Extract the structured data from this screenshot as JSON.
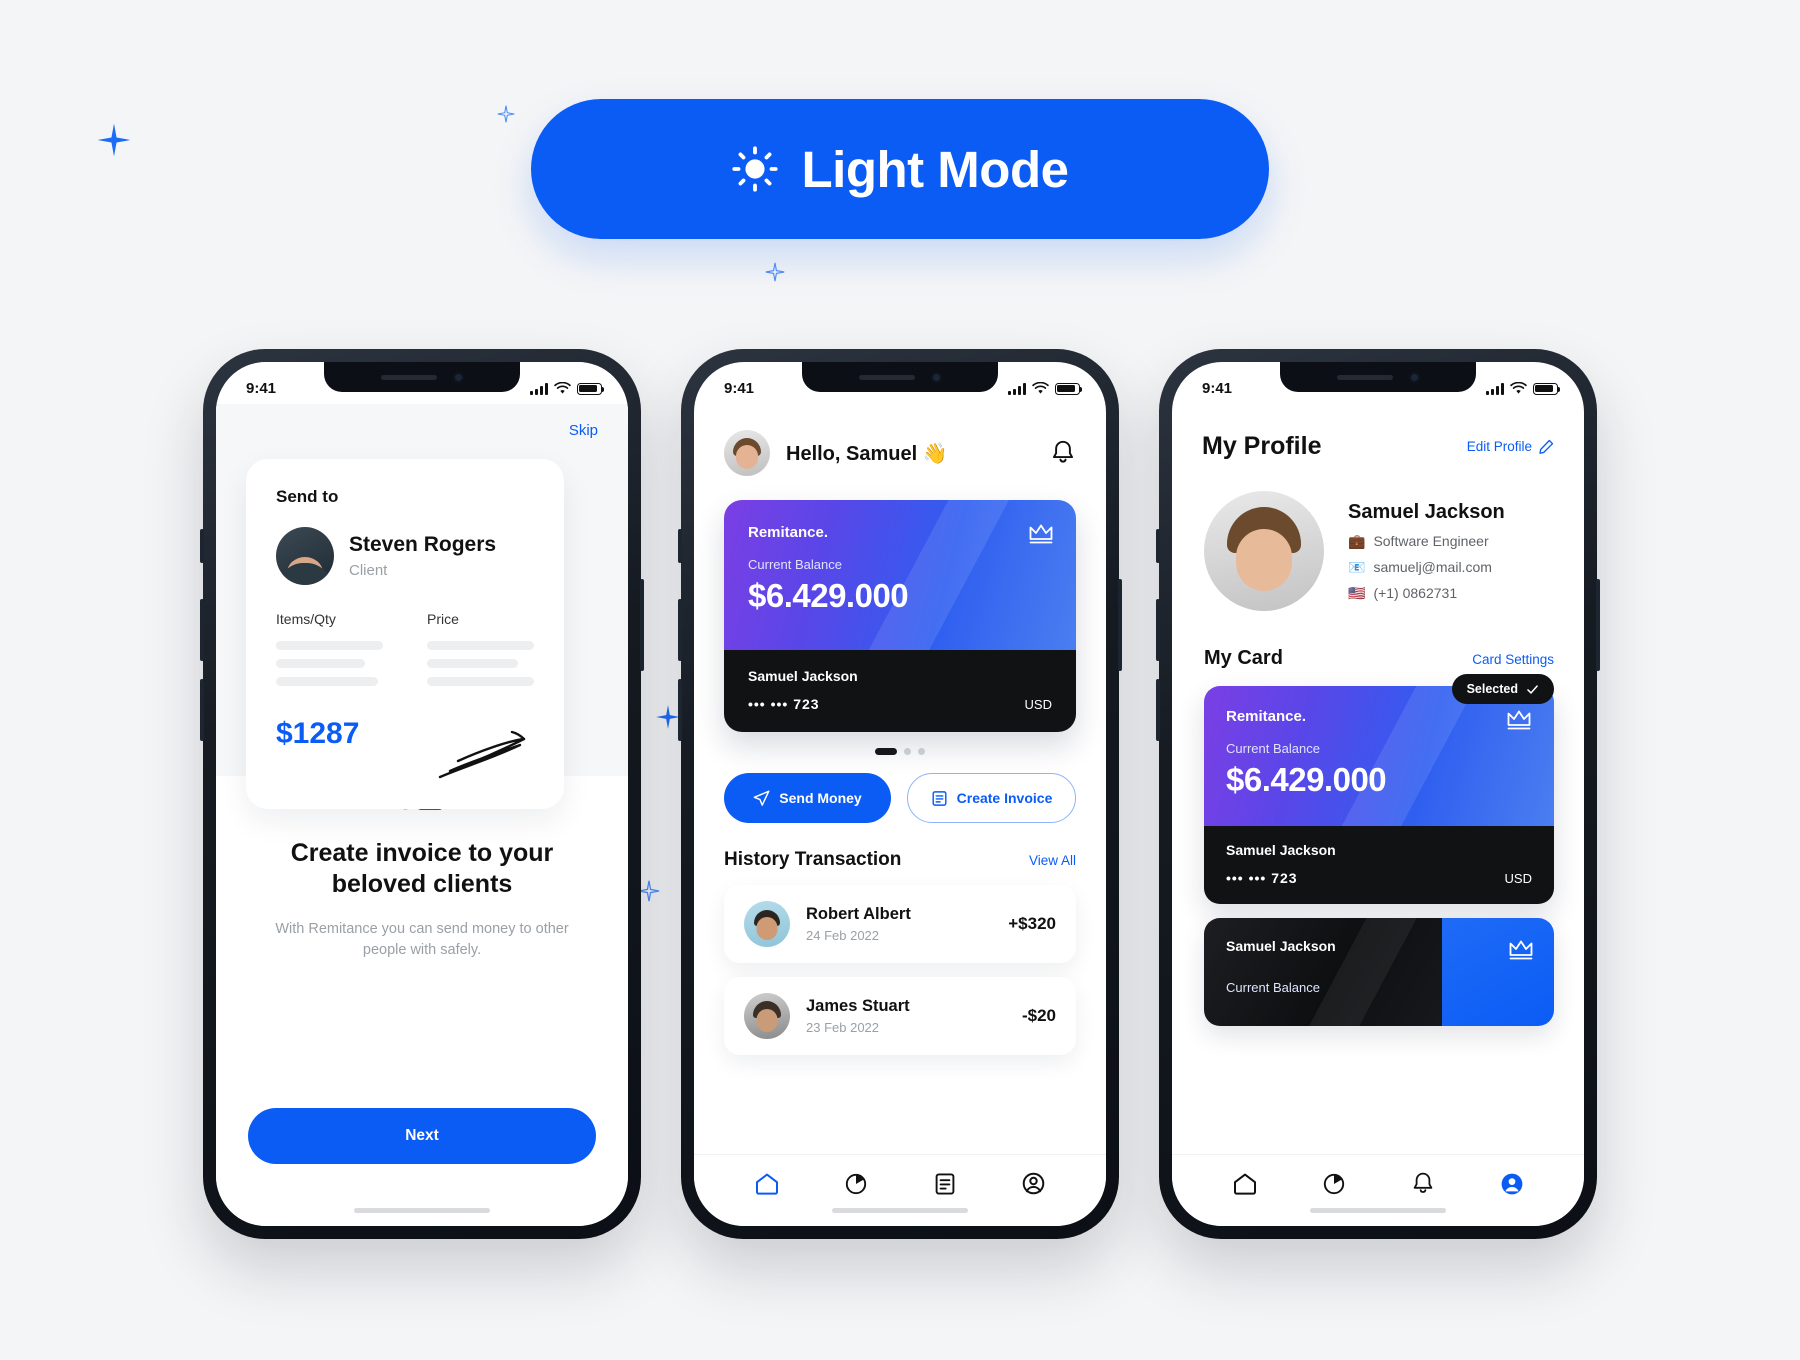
{
  "header": {
    "label": "Light Mode",
    "icon": "sun-icon",
    "accent": "#0b5cf5"
  },
  "phone1": {
    "status": {
      "time": "9:41"
    },
    "skip": "Skip",
    "card": {
      "send_to_label": "Send to",
      "client_name": "Steven Rogers",
      "client_role": "Client",
      "col_items": "Items/Qty",
      "col_price": "Price",
      "amount": "$1287",
      "signature_icon": "signature-scribble"
    },
    "pager": {
      "dots": 2,
      "active": 1
    },
    "title": "Create invoice to your beloved clients",
    "subtitle": "With Remitance you can send money to other people with safely.",
    "next_label": "Next"
  },
  "phone2": {
    "status": {
      "time": "9:41"
    },
    "greeting": "Hello, Samuel 👋",
    "bell_icon": "bell-icon",
    "card": {
      "brand": "Remitance.",
      "balance_label": "Current Balance",
      "balance_value": "$6.429.000",
      "holder": "Samuel Jackson",
      "number": "••• ••• 723",
      "currency": "USD",
      "crown_icon": "crown-icon"
    },
    "carousel": {
      "count": 3,
      "active": 0
    },
    "actions": [
      {
        "label": "Send Money",
        "icon": "send-plane-icon",
        "style": "primary"
      },
      {
        "label": "Create Invoice",
        "icon": "invoice-doc-icon",
        "style": "ghost"
      }
    ],
    "history": {
      "title": "History Transaction",
      "view_all": "View All",
      "items": [
        {
          "name": "Robert Albert",
          "date": "24 Feb 2022",
          "amount": "+$320"
        },
        {
          "name": "James Stuart",
          "date": "23 Feb 2022",
          "amount": "-$20"
        }
      ]
    },
    "tabs": [
      {
        "name": "home",
        "icon": "home-icon",
        "active": true
      },
      {
        "name": "stats",
        "icon": "pie-chart-icon",
        "active": false
      },
      {
        "name": "invoices",
        "icon": "document-icon",
        "active": false
      },
      {
        "name": "profile",
        "icon": "user-circle-icon",
        "active": false
      }
    ]
  },
  "phone3": {
    "status": {
      "time": "9:41"
    },
    "title": "My Profile",
    "edit_profile": {
      "label": "Edit Profile",
      "icon": "pencil-icon"
    },
    "profile": {
      "name": "Samuel Jackson",
      "job_emoji": "💼",
      "job": "Software Engineer",
      "email_emoji": "📧",
      "email": "samuelj@mail.com",
      "flag_emoji": "🇺🇸",
      "phone": "(+1) 0862731"
    },
    "card_section": {
      "title": "My Card",
      "settings_label": "Card Settings"
    },
    "selected_badge": {
      "label": "Selected",
      "icon": "check-icon"
    },
    "card1": {
      "brand": "Remitance.",
      "balance_label": "Current Balance",
      "balance_value": "$6.429.000",
      "holder": "Samuel Jackson",
      "number": "••• ••• 723",
      "currency": "USD",
      "crown_icon": "crown-icon"
    },
    "card2": {
      "holder": "Samuel Jackson",
      "balance_label": "Current Balance",
      "crown_icon": "crown-icon"
    },
    "tabs": [
      {
        "name": "home",
        "icon": "home-icon",
        "active": false
      },
      {
        "name": "stats",
        "icon": "pie-chart-icon",
        "active": false
      },
      {
        "name": "notifications",
        "icon": "bell-icon",
        "active": false
      },
      {
        "name": "profile",
        "icon": "user-circle-icon",
        "active": true
      }
    ]
  }
}
